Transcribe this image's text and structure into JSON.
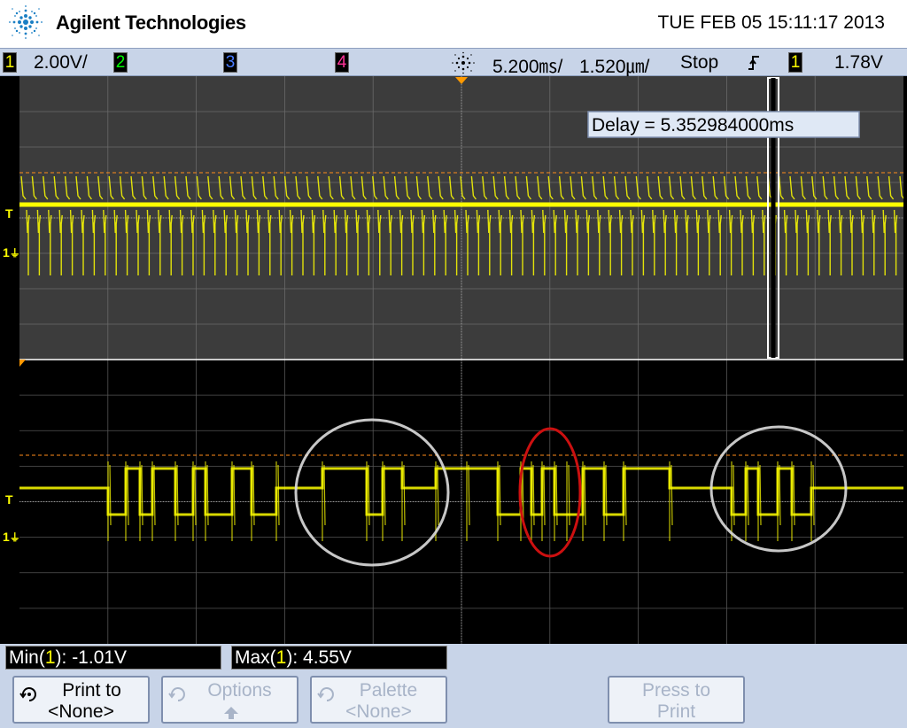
{
  "header": {
    "brand": "Agilent Technologies",
    "datetime": "TUE FEB 05 15:11:17 2013"
  },
  "status": {
    "ch1_num": "1",
    "ch1_scale": "2.00V/",
    "ch2_num": "2",
    "ch3_num": "3",
    "ch4_num": "4",
    "timebase_main": "5.200ꟷ/",
    "timebase_main_display": "5.200㎳/",
    "timebase_zoom_display": "1.520㎛/",
    "run_state": "Stop",
    "trigger_slope": "ʃ",
    "trigger_ch": "1",
    "trigger_level": "1.78V"
  },
  "scope": {
    "delay_label": "Delay = 5.352984000ms",
    "trig_marker": "T",
    "gnd_marker": "1"
  },
  "measurements": {
    "min_prefix": "Min(",
    "min_ch": "1",
    "min_suffix": "): -1.01V",
    "max_prefix": "Max(",
    "max_ch": "1",
    "max_suffix": "): 4.55V"
  },
  "softkeys": {
    "print_to_l1": "Print to",
    "print_to_l2": "<None>",
    "options_l1": "Options",
    "palette_l1": "Palette",
    "palette_l2": "<None>",
    "press_print_l1": "Press to",
    "press_print_l2": "Print"
  },
  "colors": {
    "ch1": "#ffff00",
    "ch2": "#00ff00",
    "ch3": "#4a7cff",
    "ch4": "#ff3399",
    "grid": "#777777",
    "upper_bg": "#3c3c3c",
    "lower_bg": "#000000",
    "circle_white": "#dddddd",
    "circle_red": "#cc1010"
  }
}
